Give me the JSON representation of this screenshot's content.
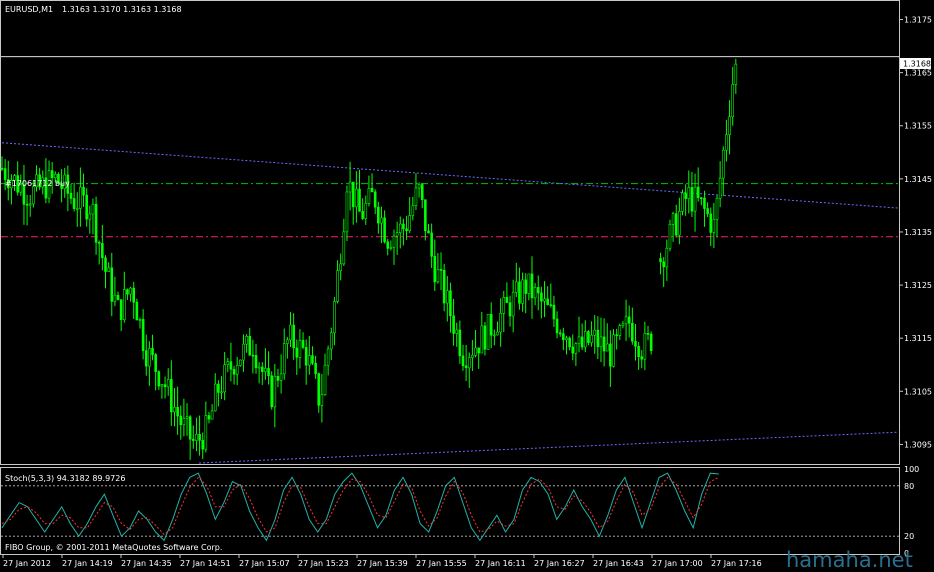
{
  "header": {
    "symbol": "EURUSD,M1",
    "ohlc": "1.3163 1.3170 1.3163 1.3168"
  },
  "order_label": "#17061712 buy",
  "copyright": "FIBO Group, © 2001-2011 MetaQuotes Software Corp.",
  "watermark": "hamaha.net",
  "colors": {
    "background": "#000000",
    "candle": "#00ff00",
    "stoch_main": "#20b2aa",
    "stoch_signal": "#ff3030",
    "trendline": "#6a6aff",
    "buy_line": "#00c000",
    "sl_line": "#ff1a75",
    "grid": "#ffffff"
  },
  "chart_data": [
    {
      "type": "candlestick",
      "title": "EURUSD,M1",
      "y_ticks": [
        "1.3175",
        "1.3165",
        "1.3155",
        "1.3145",
        "1.3135",
        "1.3125",
        "1.3115",
        "1.3105",
        "1.3095"
      ],
      "ylim": [
        1.30915,
        1.31783
      ],
      "current_price": 1.3168,
      "current_price_label": "1.3168",
      "x_ticks": [
        "27 Jan 2012",
        "27 Jan 14:19",
        "27 Jan 14:35",
        "27 Jan 14:51",
        "27 Jan 15:07",
        "27 Jan 15:23",
        "27 Jan 15:39",
        "27 Jan 15:55",
        "27 Jan 16:11",
        "27 Jan 16:27",
        "27 Jan 16:43",
        "27 Jan 17:00",
        "27 Jan 17:16"
      ],
      "horizontal_lines": [
        {
          "name": "order-buy-line",
          "value": 1.31441
        },
        {
          "name": "stop-line",
          "value": 1.31341
        }
      ],
      "trendlines": [
        {
          "name": "upper-trendline",
          "from": [
            0,
            1.31518
          ],
          "to": [
            1,
            1.31395
          ]
        },
        {
          "name": "lower-trendline",
          "from": [
            0.22,
            1.30915
          ],
          "to": [
            1,
            1.30973
          ]
        }
      ],
      "price_path": [
        [
          0,
          1.3147
        ],
        [
          0.03,
          1.3142
        ],
        [
          0.06,
          1.3145
        ],
        [
          0.08,
          1.3141
        ],
        [
          0.1,
          1.314
        ],
        [
          0.115,
          1.3128
        ],
        [
          0.13,
          1.312
        ],
        [
          0.145,
          1.3125
        ],
        [
          0.16,
          1.3113
        ],
        [
          0.18,
          1.3107
        ],
        [
          0.2,
          1.3099
        ],
        [
          0.215,
          1.3095
        ],
        [
          0.23,
          1.3098
        ],
        [
          0.24,
          1.3105
        ],
        [
          0.26,
          1.3111
        ],
        [
          0.28,
          1.3114
        ],
        [
          0.3,
          1.3104
        ],
        [
          0.32,
          1.3115
        ],
        [
          0.34,
          1.3112
        ],
        [
          0.355,
          1.3103
        ],
        [
          0.37,
          1.312
        ],
        [
          0.38,
          1.3135
        ],
        [
          0.385,
          1.3145
        ],
        [
          0.4,
          1.3138
        ],
        [
          0.415,
          1.3142
        ],
        [
          0.43,
          1.3134
        ],
        [
          0.45,
          1.3136
        ],
        [
          0.465,
          1.3143
        ],
        [
          0.48,
          1.313
        ],
        [
          0.5,
          1.312
        ],
        [
          0.515,
          1.3112
        ],
        [
          0.53,
          1.3114
        ],
        [
          0.55,
          1.3118
        ],
        [
          0.57,
          1.3122
        ],
        [
          0.585,
          1.3125
        ],
        [
          0.6,
          1.3122
        ],
        [
          0.62,
          1.3118
        ],
        [
          0.645,
          1.3113
        ],
        [
          0.66,
          1.3115
        ],
        [
          0.68,
          1.3112
        ],
        [
          0.7,
          1.3118
        ],
        [
          0.715,
          1.3113
        ],
        [
          0.725,
          1.3115
        ]
      ],
      "price_path_2": [
        [
          0.735,
          1.313
        ],
        [
          0.75,
          1.3136
        ],
        [
          0.765,
          1.3142
        ],
        [
          0.78,
          1.314
        ],
        [
          0.795,
          1.3136
        ],
        [
          0.805,
          1.315
        ],
        [
          0.815,
          1.3163
        ],
        [
          0.822,
          1.3168
        ]
      ]
    },
    {
      "type": "line",
      "title": "Stoch(5,3,3) 94.3182 89.9726",
      "ylim": [
        0,
        100
      ],
      "y_ticks": [
        "100",
        "80",
        "20",
        "0"
      ],
      "levels": [
        80,
        20
      ],
      "series": [
        {
          "key": "main",
          "values": [
            30,
            45,
            60,
            55,
            40,
            25,
            40,
            55,
            35,
            20,
            35,
            55,
            70,
            45,
            20,
            30,
            50,
            40,
            25,
            15,
            40,
            70,
            90,
            95,
            70,
            40,
            60,
            85,
            80,
            50,
            30,
            15,
            40,
            75,
            90,
            70,
            40,
            25,
            40,
            70,
            85,
            95,
            80,
            55,
            30,
            45,
            75,
            90,
            70,
            35,
            25,
            50,
            80,
            90,
            60,
            30,
            15,
            30,
            45,
            25,
            40,
            75,
            90,
            85,
            70,
            40,
            55,
            75,
            55,
            40,
            20,
            45,
            75,
            90,
            60,
            30,
            60,
            90,
            95,
            75,
            50,
            30,
            70,
            95,
            94
          ]
        },
        {
          "key": "signal",
          "values": [
            35,
            40,
            52,
            55,
            48,
            35,
            35,
            45,
            42,
            30,
            30,
            45,
            60,
            55,
            35,
            28,
            40,
            42,
            33,
            22,
            30,
            55,
            78,
            90,
            80,
            55,
            55,
            75,
            82,
            65,
            42,
            25,
            30,
            60,
            80,
            78,
            55,
            35,
            35,
            55,
            75,
            88,
            85,
            68,
            45,
            42,
            62,
            82,
            78,
            50,
            32,
            42,
            68,
            85,
            72,
            45,
            25,
            28,
            38,
            32,
            35,
            60,
            82,
            88,
            78,
            55,
            52,
            68,
            62,
            48,
            30,
            38,
            62,
            82,
            72,
            45,
            52,
            78,
            90,
            82,
            62,
            42,
            58,
            85,
            90
          ]
        }
      ]
    }
  ]
}
